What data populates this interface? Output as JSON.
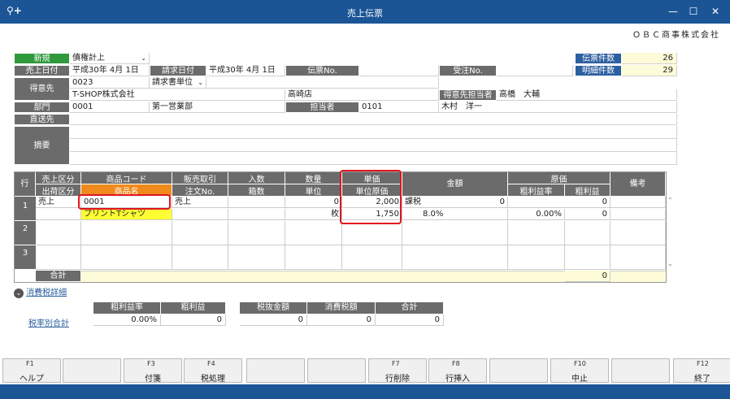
{
  "window": {
    "title": "売上伝票",
    "search_icon": "⚲+",
    "min": "—",
    "max": "☐",
    "close": "✕"
  },
  "company": "ＯＢＣ商事株式会社",
  "header": {
    "new_label": "新規",
    "type_value": "債権計上",
    "sales_date_label": "売上日付",
    "sales_date": "平成30年  4月  1日",
    "billing_date_label": "請求日付",
    "billing_date": "平成30年  4月  1日",
    "slip_no_label": "伝票No.",
    "order_no_label": "受注No.",
    "slip_count_label": "伝票件数",
    "slip_count": "26",
    "detail_count_label": "明細件数",
    "detail_count": "29",
    "customer_label": "得意先",
    "customer_code": "0023",
    "billing_unit": "請求書単位",
    "customer_name": "T-SHOP株式会社",
    "branch": "高崎店",
    "customer_contact_label": "得意先担当者",
    "customer_contact": "高橋　大輔",
    "dept_label": "部門",
    "dept_code": "0001",
    "dept_name": "第一営業部",
    "staff_label": "担当者",
    "staff_code": "0101",
    "staff_name": "木村　洋一",
    "shipto_label": "直送先",
    "memo_label": "摘要"
  },
  "grid": {
    "row_label": "行",
    "h1": {
      "sales_type": "売上区分",
      "product_code": "商品コード",
      "sales_trade": "販売取引",
      "qty_per": "入数",
      "quantity": "数量",
      "unit_price": "単価",
      "amount": "金額",
      "cost": "原価",
      "remarks": "備考"
    },
    "h2": {
      "ship_type": "出荷区分",
      "product_name": "商品名",
      "order_no": "注文No.",
      "boxes": "箱数",
      "unit": "単位",
      "unit_cost": "単位原価",
      "margin_rate": "粗利益率",
      "margin": "粗利益"
    },
    "rows": [
      {
        "no": "1",
        "sales_type": "売上",
        "product_code": "0001",
        "sales_trade": "売上",
        "quantity": "0",
        "unit_price": "2,000",
        "tax": "課税",
        "amount": "0",
        "cost": "0",
        "product_name": "プリントTシャツ",
        "unit": "枚",
        "unit_cost": "1,750",
        "tax_rate": "8.0%",
        "margin_rate": "0.00%",
        "margin": "0"
      },
      {
        "no": "2"
      },
      {
        "no": "3"
      }
    ],
    "total_label": "合計",
    "total_margin": "0"
  },
  "tax_detail": {
    "toggle": "消費税詳細",
    "rate_total_label": "税率別合計",
    "h": {
      "margin_rate": "粗利益率",
      "margin": "粗利益",
      "pretax": "税抜金額",
      "tax": "消費税額",
      "total": "合計"
    },
    "v": {
      "margin_rate": "0.00%",
      "margin": "0",
      "pretax": "0",
      "tax": "0",
      "total": "0"
    }
  },
  "fkeys": [
    {
      "k": "F1",
      "l": "ヘルプ"
    },
    {
      "k": "",
      "l": ""
    },
    {
      "k": "F3",
      "l": "付箋"
    },
    {
      "k": "F4",
      "l": "税処理"
    },
    {
      "k": "",
      "l": ""
    },
    {
      "k": "",
      "l": ""
    },
    {
      "k": "F7",
      "l": "行削除"
    },
    {
      "k": "F8",
      "l": "行挿入"
    },
    {
      "k": "",
      "l": ""
    },
    {
      "k": "F10",
      "l": "中止"
    },
    {
      "k": "",
      "l": ""
    },
    {
      "k": "F12",
      "l": "終了"
    }
  ]
}
